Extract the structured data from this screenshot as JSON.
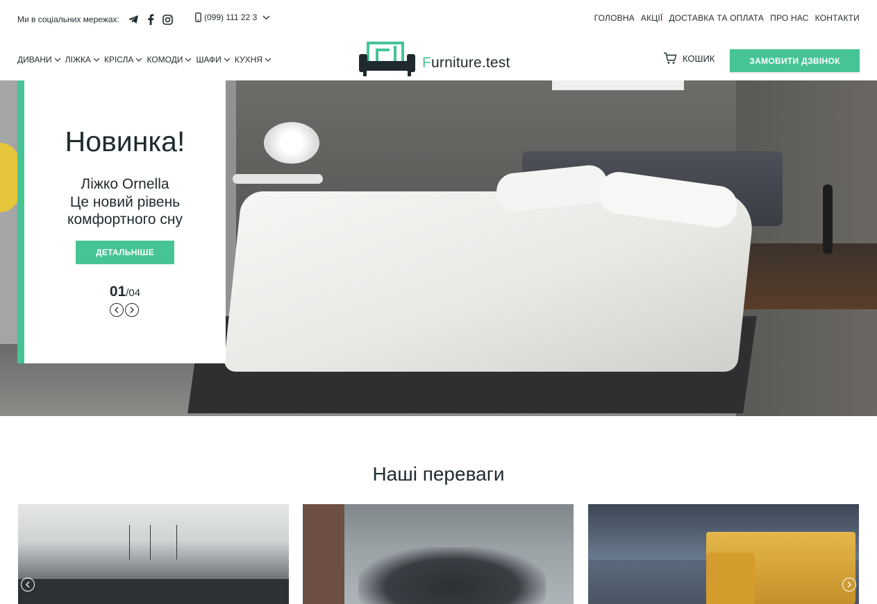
{
  "topbar": {
    "social_label": "Ми в соціальних мережах:",
    "social_icons": [
      "telegram-icon",
      "facebook-icon",
      "instagram-icon"
    ],
    "phone": "(099) 111 22 3",
    "nav": [
      "ГОЛОВНА",
      "АКЦІЇ",
      "ДОСТАВКА ТА ОПЛАТА",
      "ПРО НАС",
      "КОНТАКТИ"
    ]
  },
  "categories": [
    "ДИВАНИ",
    "ЛІЖКА",
    "КРІСЛА",
    "КОМОДИ",
    "ШАФИ",
    "КУХНЯ"
  ],
  "logo": {
    "first_letter": "F",
    "rest": "urniture.test"
  },
  "cart": {
    "label": "КОШИК"
  },
  "call_button": {
    "label": "ЗАМОВИТИ ДЗВІНОК"
  },
  "hero": {
    "title": "Новинка!",
    "product": "Ліжко Ornella",
    "description_line1": "Це новий рівень",
    "description_line2": "комфортного сну",
    "button": "ДЕТАЛЬНІШЕ",
    "slide_current": "01",
    "slide_total": "/04"
  },
  "advantages": {
    "title": "Наші переваги"
  },
  "colors": {
    "accent": "#47c496",
    "text": "#1f2a2e"
  }
}
